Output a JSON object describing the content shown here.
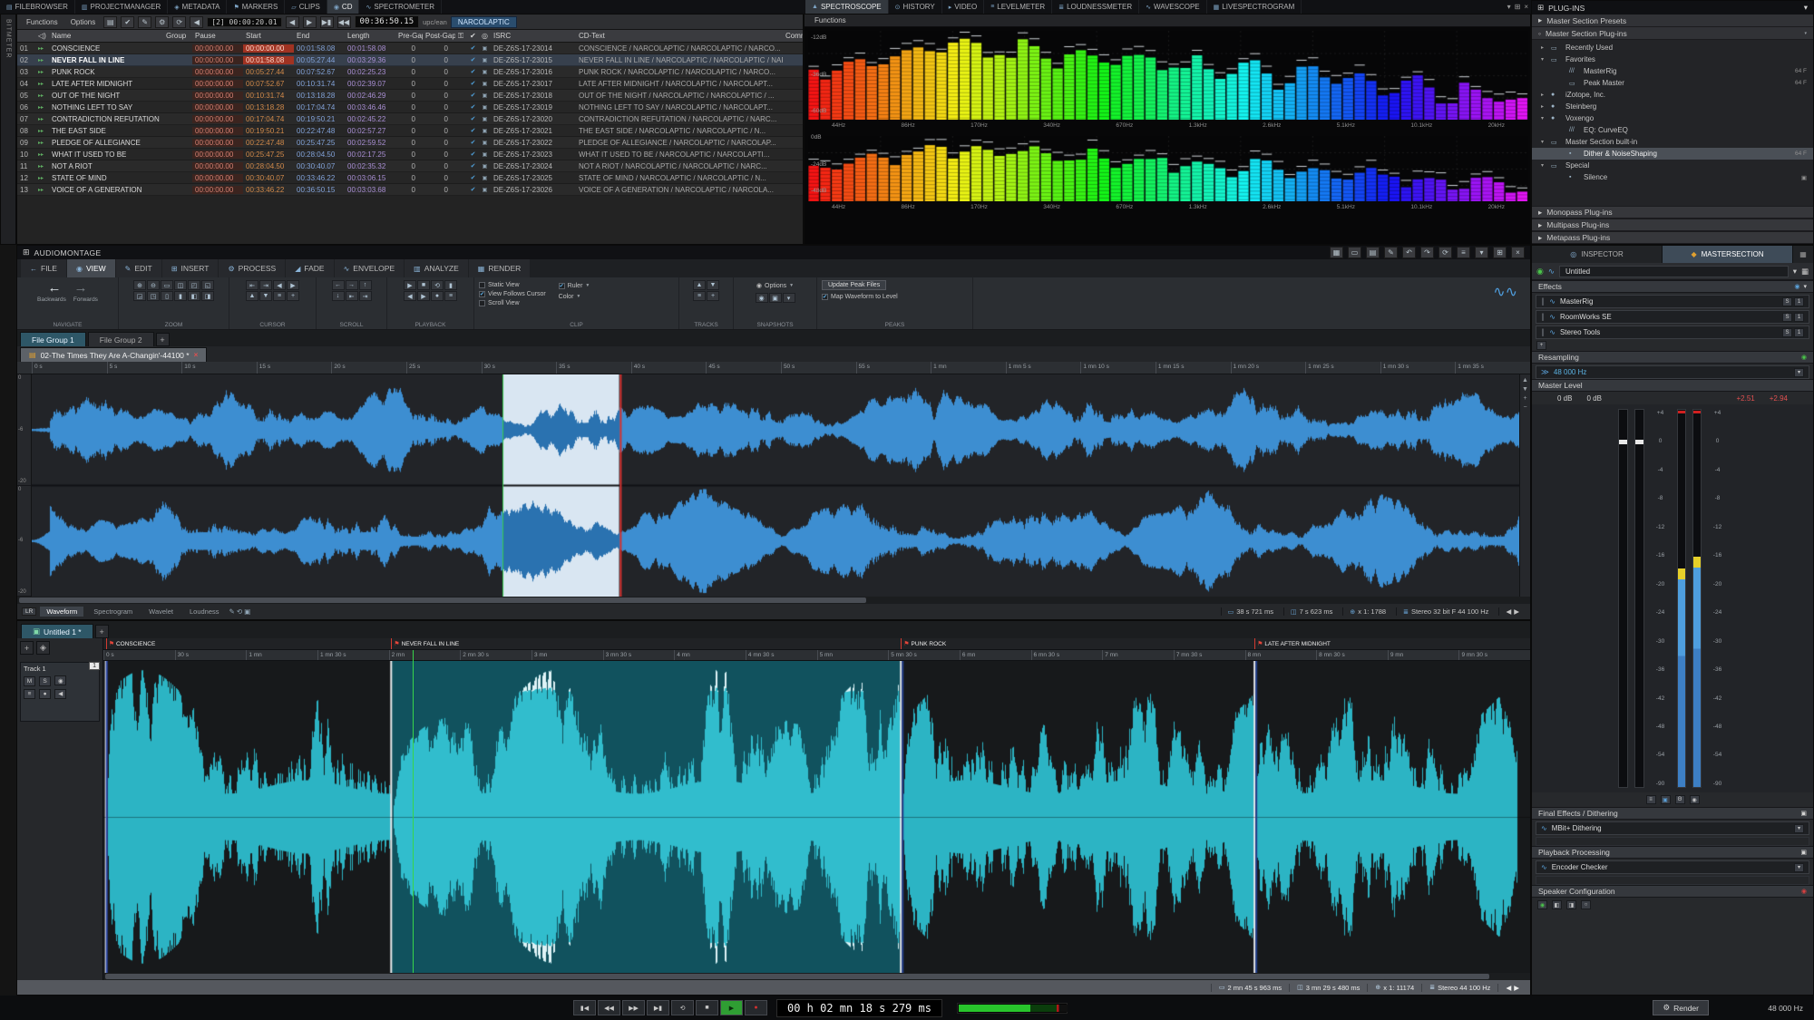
{
  "left_strip": {
    "label": "BITMETER"
  },
  "menubar": {
    "left_tabs": [
      {
        "icon": "▤",
        "label": "FILEBROWSER"
      },
      {
        "icon": "▥",
        "label": "PROJECTMANAGER"
      },
      {
        "icon": "◈",
        "label": "METADATA"
      },
      {
        "icon": "⚑",
        "label": "MARKERS"
      },
      {
        "icon": "▱",
        "label": "CLIPS"
      },
      {
        "icon": "◉",
        "label": "CD",
        "_class": "active"
      },
      {
        "icon": "∿",
        "label": "SPECTROMETER"
      }
    ],
    "right_tabs": [
      {
        "icon": "▲",
        "label": "SPECTROSCOPE",
        "_class": "active"
      },
      {
        "icon": "⊙",
        "label": "HISTORY"
      },
      {
        "icon": "▸",
        "label": "VIDEO"
      },
      {
        "icon": "≡",
        "label": "LEVELMETER"
      },
      {
        "icon": "≣",
        "label": "LOUDNESSMETER"
      },
      {
        "icon": "∿",
        "label": "WAVESCOPE"
      },
      {
        "icon": "▦",
        "label": "LIVESPECTROGRAM"
      }
    ],
    "window_icons": [
      "▾",
      "⊞",
      "×"
    ]
  },
  "cd_panel": {
    "menus": [
      "Functions",
      "Options"
    ],
    "toolbar_icons": [
      "▤",
      "✔",
      "✎",
      "⚙",
      "⟳"
    ],
    "counter": "[2]",
    "pregap_time": "00:00:20.01",
    "transport_icons": [
      "◀",
      "▶",
      "▶▮",
      "◀◀"
    ],
    "total_time": "00:36:50.15",
    "upc_label": "upc/ean",
    "album_title": "NARCOLAPTIC",
    "columns": {
      "name": "Name",
      "group": "Group",
      "pause": "Pause",
      "start": "Start",
      "end": "End",
      "length": "Length",
      "pregap": "Pre-Gap",
      "postgap": "Post-Gap",
      "isrc": "ISRC",
      "cdtext": "CD-Text",
      "comment": "Comment"
    },
    "rows": [
      {
        "num": "01",
        "name": "CONSCIENCE",
        "pause": "00:00:00.00",
        "start": "00:00:00.00",
        "end": "00:01:58.08",
        "length": "00:01:58.08",
        "pre": "0",
        "post": "0",
        "isrc": "DE-Z6S-17-23014",
        "cdtext": "CONSCIENCE / NARCOLAPTIC / NARCOLAPTIC / NARCO...",
        "_class": "hl-start"
      },
      {
        "num": "02",
        "name": "NEVER FALL IN LINE",
        "pause": "00:00:00.00",
        "start": "00:01:58.08",
        "end": "00:05:27.44",
        "length": "00:03:29.36",
        "pre": "0",
        "post": "0",
        "isrc": "DE-Z6S-17-23015",
        "cdtext": "NEVER FALL IN LINE / NARCOLAPTIC / NARCOLAPTIC / NARC...",
        "_class": "sel hl-start"
      },
      {
        "num": "03",
        "name": "PUNK ROCK",
        "pause": "00:00:00.00",
        "start": "00:05:27.44",
        "end": "00:07:52.67",
        "length": "00:02:25.23",
        "pre": "0",
        "post": "0",
        "isrc": "DE-Z6S-17-23016",
        "cdtext": "PUNK ROCK / NARCOLAPTIC / NARCOLAPTIC / NARCO..."
      },
      {
        "num": "04",
        "name": "LATE AFTER MIDNIGHT",
        "pause": "00:00:00.00",
        "start": "00:07:52.67",
        "end": "00:10:31.74",
        "length": "00:02:39.07",
        "pre": "0",
        "post": "0",
        "isrc": "DE-Z6S-17-23017",
        "cdtext": "LATE AFTER MIDNIGHT / NARCOLAPTIC / NARCOLAPT..."
      },
      {
        "num": "05",
        "name": "OUT OF THE NIGHT",
        "pause": "00:00:00.00",
        "start": "00:10:31.74",
        "end": "00:13:18.28",
        "length": "00:02:46.29",
        "pre": "0",
        "post": "0",
        "isrc": "DE-Z6S-17-23018",
        "cdtext": "OUT OF THE NIGHT / NARCOLAPTIC / NARCOLAPTIC / ..."
      },
      {
        "num": "06",
        "name": "NOTHING LEFT TO SAY",
        "pause": "00:00:00.00",
        "start": "00:13:18.28",
        "end": "00:17:04.74",
        "length": "00:03:46.46",
        "pre": "0",
        "post": "0",
        "isrc": "DE-Z6S-17-23019",
        "cdtext": "NOTHING LEFT TO SAY / NARCOLAPTIC / NARCOLAPT..."
      },
      {
        "num": "07",
        "name": "CONTRADICTION REFUTATION",
        "pause": "00:00:00.00",
        "start": "00:17:04.74",
        "end": "00:19:50.21",
        "length": "00:02:45.22",
        "pre": "0",
        "post": "0",
        "isrc": "DE-Z6S-17-23020",
        "cdtext": "CONTRADICTION REFUTATION / NARCOLAPTIC / NARC..."
      },
      {
        "num": "08",
        "name": "THE EAST SIDE",
        "pause": "00:00:00.00",
        "start": "00:19:50.21",
        "end": "00:22:47.48",
        "length": "00:02:57.27",
        "pre": "0",
        "post": "0",
        "isrc": "DE-Z6S-17-23021",
        "cdtext": "THE EAST SIDE / NARCOLAPTIC / NARCOLAPTIC / N..."
      },
      {
        "num": "09",
        "name": "PLEDGE OF ALLEGIANCE",
        "pause": "00:00:00.00",
        "start": "00:22:47.48",
        "end": "00:25:47.25",
        "length": "00:02:59.52",
        "pre": "0",
        "post": "0",
        "isrc": "DE-Z6S-17-23022",
        "cdtext": "PLEDGE OF ALLEGIANCE / NARCOLAPTIC / NARCOLAP..."
      },
      {
        "num": "10",
        "name": "WHAT IT USED TO BE",
        "pause": "00:00:00.00",
        "start": "00:25:47.25",
        "end": "00:28:04.50",
        "length": "00:02:17.25",
        "pre": "0",
        "post": "0",
        "isrc": "DE-Z6S-17-23023",
        "cdtext": "WHAT IT USED TO BE / NARCOLAPTIC / NARCOLAPTI..."
      },
      {
        "num": "11",
        "name": "NOT A RIOT",
        "pause": "00:00:00.00",
        "start": "00:28:04.50",
        "end": "00:30:40.07",
        "length": "00:02:35.32",
        "pre": "0",
        "post": "0",
        "isrc": "DE-Z6S-17-23024",
        "cdtext": "NOT A RIOT / NARCOLAPTIC / NARCOLAPTIC / NARC..."
      },
      {
        "num": "12",
        "name": "STATE OF MIND",
        "pause": "00:00:00.00",
        "start": "00:30:40.07",
        "end": "00:33:46.22",
        "length": "00:03:06.15",
        "pre": "0",
        "post": "0",
        "isrc": "DE-Z6S-17-23025",
        "cdtext": "STATE OF MIND / NARCOLAPTIC / NARCOLAPTIC / N..."
      },
      {
        "num": "13",
        "name": "VOICE OF A GENERATION",
        "pause": "00:00:00.00",
        "start": "00:33:46.22",
        "end": "00:36:50.15",
        "length": "00:03:03.68",
        "pre": "0",
        "post": "0",
        "isrc": "DE-Z6S-17-23026",
        "cdtext": "VOICE OF A GENERATION / NARCOLAPTIC / NARCOLA..."
      }
    ]
  },
  "spectroscope": {
    "menu": "Functions",
    "db_top": [
      "-12dB",
      "-36dB",
      "-60dB"
    ],
    "db_bottom": [
      "0dB",
      "-24dB",
      "-48dB"
    ],
    "freqs": [
      "44Hz",
      "86Hz",
      "170Hz",
      "340Hz",
      "670Hz",
      "1.3kHz",
      "2.6kHz",
      "5.1kHz",
      "10.1kHz",
      "20kHz"
    ]
  },
  "plugins": {
    "title": "PLUG-INS",
    "presets_row": "Master Section Presets",
    "section_row": "Master Section Plug-ins",
    "tree": [
      {
        "arrow": "▸",
        "icon": "▭",
        "label": "Recently Used",
        "_class": "d1"
      },
      {
        "arrow": "▾",
        "icon": "▭",
        "label": "Favorites",
        "_class": "d1"
      },
      {
        "icon": "///",
        "label": "MasterRig",
        "badge": "64 F",
        "_class": "d2"
      },
      {
        "icon": "▭",
        "label": "Peak Master",
        "badge": "64 F",
        "_class": "d2"
      },
      {
        "arrow": "▸",
        "icon": "●",
        "label": "iZotope, Inc.",
        "_class": "d1"
      },
      {
        "arrow": "▸",
        "icon": "●",
        "label": "Steinberg",
        "_class": "d1"
      },
      {
        "arrow": "▾",
        "icon": "●",
        "label": "Voxengo",
        "_class": "d1"
      },
      {
        "icon": "///",
        "label": "EQ: CurveEQ",
        "_class": "d2"
      },
      {
        "arrow": "▾",
        "icon": "▭",
        "label": "Master Section built-in",
        "_class": "d1"
      },
      {
        "icon": "▪",
        "label": "Dither & NoiseShaping",
        "badge": "64 F",
        "_class": "d2 sel"
      },
      {
        "arrow": "▾",
        "icon": "▭",
        "label": "Special",
        "_class": "d1"
      },
      {
        "icon": "▪",
        "label": "Silence",
        "badge": "▣",
        "_class": "d2"
      }
    ],
    "footer_rows": [
      "Monopass Plug-ins",
      "Multipass Plug-ins",
      "Metapass Plug-ins"
    ]
  },
  "editor": {
    "panel_title": "AUDIOMONTAGE",
    "title_icons": [
      "▦",
      "▭",
      "▤",
      "✎",
      "↶",
      "↷",
      "⟳",
      "≡",
      "▾",
      "⊞",
      "×"
    ],
    "tabs": [
      {
        "icon": "←",
        "label": "FILE"
      },
      {
        "icon": "◉",
        "label": "VIEW",
        "_class": "active"
      },
      {
        "icon": "✎",
        "label": "EDIT"
      },
      {
        "icon": "⊞",
        "label": "INSERT"
      },
      {
        "icon": "⚙",
        "label": "PROCESS"
      },
      {
        "icon": "◢",
        "label": "FADE"
      },
      {
        "icon": "∿",
        "label": "ENVELOPE"
      },
      {
        "icon": "▥",
        "label": "ANALYZE"
      },
      {
        "icon": "▦",
        "label": "RENDER"
      }
    ],
    "ribbon": {
      "navigate_back": "Backwards",
      "navigate_fwd": "Forwards",
      "zoom_icons": [
        "⊕",
        "⊖",
        "▭",
        "◫",
        "◰",
        "◱",
        "◲",
        "◳",
        "▯",
        "▮",
        "◧",
        "◨"
      ],
      "cursor_icons": [
        "⇤",
        "⇥",
        "◀",
        "▶",
        "▲",
        "▼",
        "≡",
        "+"
      ],
      "scroll_icons": [
        "←",
        "→",
        "↑",
        "↓",
        "⇤",
        "⇥"
      ],
      "playback_icons": [
        "▶",
        "■",
        "⟲",
        "▮",
        "◀",
        "▶",
        "●",
        "≡"
      ],
      "clip_checks": [
        {
          "label": "Static View",
          "mark": ""
        },
        {
          "label": "View Follows Cursor",
          "mark": "✔"
        },
        {
          "label": "Scroll View",
          "mark": ""
        }
      ],
      "ruler_label": "Ruler",
      "color_label": "Color",
      "tracks_icons": [
        "▲",
        "▼",
        "≡",
        "+"
      ],
      "snapshots_label": "Options",
      "snapshots_icons": [
        "◉",
        "▣",
        "▾"
      ],
      "peaks_button": "Update Peak Files",
      "peaks_check": "Map Waveform to Level",
      "labels": [
        "NAVIGATE",
        "ZOOM",
        "CURSOR",
        "SCROLL",
        "PLAYBACK",
        "CLIP",
        "TRACKS",
        "SNAPSHOTS",
        "PEAKS"
      ]
    },
    "file_tabs": [
      {
        "label": "File Group 1",
        "_class": "active"
      },
      {
        "label": "File Group 2"
      }
    ],
    "new_tab": "+",
    "doc_tab": "02-The Times They Are A-Changin'-44100 *",
    "ruler_ticks": [
      "0 s",
      "5 s",
      "10 s",
      "15 s",
      "20 s",
      "25 s",
      "30 s",
      "35 s",
      "40 s",
      "45 s",
      "50 s",
      "55 s",
      "1 mn",
      "1 mn 5 s",
      "1 mn 10 s",
      "1 mn 15 s",
      "1 mn 20 s",
      "1 mn 25 s",
      "1 mn 30 s",
      "1 mn 35 s"
    ],
    "db_scale_half": [
      "0",
      "-6",
      "-20"
    ],
    "view": {
      "total_s": 97,
      "sel_start_s": 30.7,
      "sel_end_s": 38.3,
      "cursor_s": 38.35
    },
    "channel_tab": "LR",
    "view_tabs": [
      {
        "label": "Waveform",
        "_class": "active"
      },
      {
        "label": "Spectrogram"
      },
      {
        "label": "Wavelet"
      },
      {
        "label": "Loudness"
      }
    ],
    "status": [
      {
        "icon": "▭",
        "text": "38 s 721 ms"
      },
      {
        "icon": "◫",
        "text": "7 s 623 ms"
      },
      {
        "icon": "⊕",
        "text": "x 1: 1788"
      },
      {
        "icon": "≣",
        "text": "Stereo 32 bit F 44 100 Hz"
      }
    ]
  },
  "montage": {
    "doc_tab": "Untitled 1 *",
    "new_tab": "+",
    "track": {
      "num": "1",
      "name": "Track 1",
      "mute": "M",
      "solo": "S",
      "eye": "◉",
      "route_icons": [
        "≡",
        "●",
        "◀"
      ]
    },
    "ruler_ticks": [
      "0 s",
      "30 s",
      "1 mn",
      "1 mn 30 s",
      "2 mn",
      "2 mn 30 s",
      "3 mn",
      "3 mn 30 s",
      "4 mn",
      "4 mn 30 s",
      "5 mn",
      "5 mn 30 s",
      "6 mn",
      "6 mn 30 s",
      "7 mn",
      "7 mn 30 s",
      "8 mn",
      "8 mn 30 s",
      "9 mn",
      "9 mn 30 s"
    ],
    "timeline": {
      "total_s": 585,
      "markers": [
        {
          "label": "CONSCIENCE",
          "t": 1
        },
        {
          "label": "NEVER FALL IN LINE",
          "t": 118
        },
        {
          "label": "PUNK ROCK",
          "t": 327
        },
        {
          "label": "LATE AFTER MIDNIGHT",
          "t": 472
        }
      ],
      "selected": [
        118,
        327
      ],
      "playhead_s": 127
    },
    "status": [
      {
        "icon": "▭",
        "text": "2 mn 45 s 963 ms"
      },
      {
        "icon": "◫",
        "text": "3 mn 29 s 480 ms"
      },
      {
        "icon": "⊕",
        "text": "x 1: 11174"
      },
      {
        "icon": "≣",
        "text": "Stereo 44 100 Hz"
      }
    ]
  },
  "inspector": {
    "tabs": [
      {
        "icon": "◎",
        "label": "INSPECTOR",
        "iclass": "ti-i"
      },
      {
        "icon": "◆",
        "label": "MASTERSECTION",
        "iclass": "ti-m",
        "_class": "active"
      }
    ],
    "preset_name": "Untitled",
    "effects_header": "Effects",
    "effects": [
      {
        "name": "MasterRig"
      },
      {
        "name": "RoomWorks SE"
      },
      {
        "name": "Stereo Tools"
      }
    ],
    "slot_s": "S",
    "slot_n": "1",
    "resampling_header": "Resampling",
    "resampling_value": "48 000 Hz",
    "master_header": "Master Level",
    "gain_l": "0 dB",
    "gain_r": "0 dB",
    "peak_l": "+2.51",
    "peak_r": "+2.94",
    "scale": [
      "+4",
      "0",
      "-4",
      "-8",
      "-12",
      "-16",
      "-20",
      "-24",
      "-30",
      "-36",
      "-42",
      "-48",
      "-54",
      "-90"
    ],
    "final_header": "Final Effects / Dithering",
    "dither_slot": "MBit+ Dithering",
    "playback_header": "Playback Processing",
    "playback_slot": "Encoder Checker",
    "speaker_header": "Speaker Configuration",
    "render_label": "Render",
    "samplerate_label": "48 000 Hz"
  },
  "transport": {
    "buttons": [
      {
        "g": "▮◀"
      },
      {
        "g": "◀◀"
      },
      {
        "g": "▶▶"
      },
      {
        "g": "▶▮"
      },
      {
        "g": "⟲"
      },
      {
        "g": "■"
      },
      {
        "g": "▶",
        "_class": "play"
      },
      {
        "g": "●",
        "_class": "rec"
      }
    ],
    "time": "00 h 02 mn 18 s 279 ms"
  }
}
